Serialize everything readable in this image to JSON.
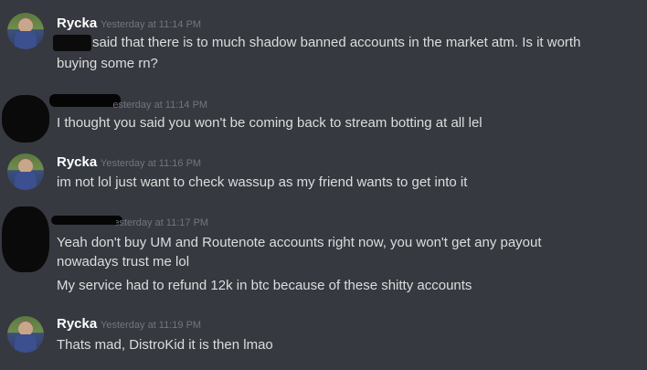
{
  "messages": [
    {
      "author": "Rycka",
      "timestamp": "Yesterday at 11:14 PM",
      "lines": [
        "said that there is to much shadow banned accounts in the market atm. Is it worth",
        "buying some rn?"
      ]
    },
    {
      "author": "",
      "timestamp": "Yesterday at 11:14 PM",
      "lines": [
        "I thought you said you won't be coming back to stream botting at all lel"
      ]
    },
    {
      "author": "Rycka",
      "timestamp": "Yesterday at 11:16 PM",
      "lines": [
        "im not lol just want to check wassup as my friend wants to get into it"
      ]
    },
    {
      "author": "",
      "timestamp": "Yesterday at 11:17 PM",
      "lines": [
        "Yeah don't buy UM and Routenote accounts right now, you won't get any payout",
        "nowadays trust me lol",
        "My service had to refund 12k in btc because of these shitty accounts"
      ]
    },
    {
      "author": "Rycka",
      "timestamp": "Yesterday at 11:19 PM",
      "lines": [
        "Thats mad, DistroKid it is then lmao"
      ]
    }
  ],
  "colors": {
    "background": "#36393f",
    "author": "#ffffff",
    "timestamp": "#72767d",
    "text": "#dcddde"
  }
}
